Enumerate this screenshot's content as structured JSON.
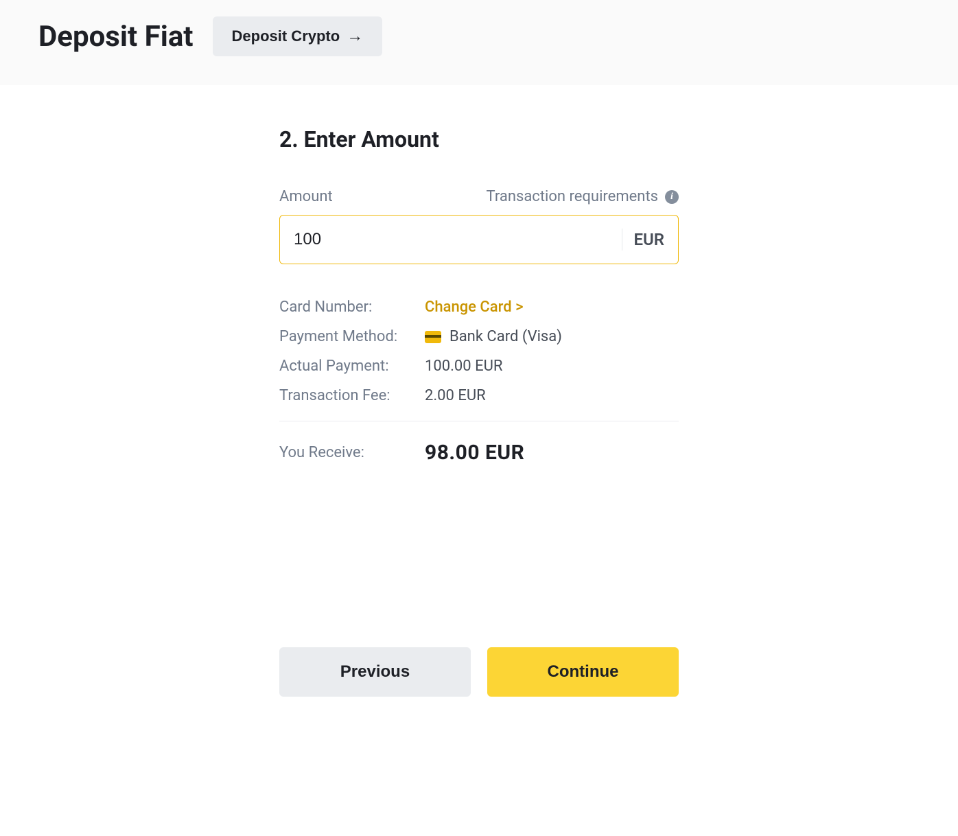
{
  "header": {
    "title": "Deposit Fiat",
    "depositCryptoLabel": "Deposit Crypto"
  },
  "step": {
    "title": "2. Enter Amount"
  },
  "amount": {
    "label": "Amount",
    "txRequirementsLabel": "Transaction requirements",
    "value": "100",
    "currency": "EUR"
  },
  "details": {
    "cardNumberLabel": "Card Number:",
    "changeCardLabel": "Change Card >",
    "paymentMethodLabel": "Payment Method:",
    "paymentMethodValue": "Bank Card (Visa)",
    "actualPaymentLabel": "Actual Payment:",
    "actualPaymentValue": "100.00 EUR",
    "transactionFeeLabel": "Transaction Fee:",
    "transactionFeeValue": "2.00 EUR"
  },
  "receive": {
    "label": "You Receive:",
    "value": "98.00  EUR"
  },
  "buttons": {
    "previous": "Previous",
    "continue": "Continue"
  }
}
